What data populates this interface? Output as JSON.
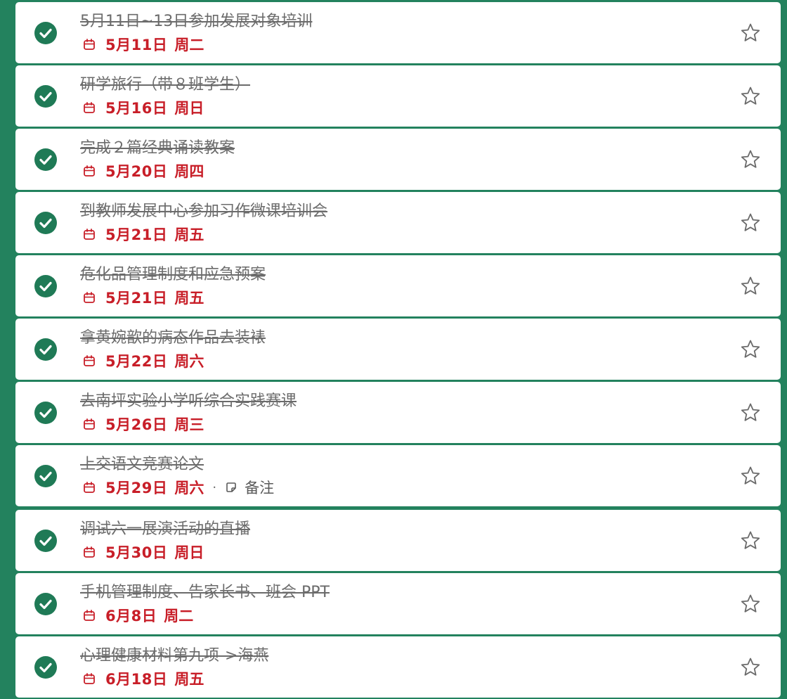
{
  "tasks": [
    {
      "title": "5月11日~13日参加发展对象培训",
      "date": "5月11日",
      "weekday": "周二",
      "completed": true,
      "starred": false
    },
    {
      "title": "研学旅行（带８班学生）",
      "date": "5月16日",
      "weekday": "周日",
      "completed": true,
      "starred": false
    },
    {
      "title": "完成２篇经典诵读教案",
      "date": "5月20日",
      "weekday": "周四",
      "completed": true,
      "starred": false
    },
    {
      "title": "到教师发展中心参加习作微课培训会",
      "date": "5月21日",
      "weekday": "周五",
      "completed": true,
      "starred": false
    },
    {
      "title": "危化品管理制度和应急预案",
      "date": "5月21日",
      "weekday": "周五",
      "completed": true,
      "starred": false
    },
    {
      "title": "拿黄婉歆的病态作品去装裱",
      "date": "5月22日",
      "weekday": "周六",
      "completed": true,
      "starred": false
    },
    {
      "title": "去南坪实验小学听综合实践赛课",
      "date": "5月26日",
      "weekday": "周三",
      "completed": true,
      "starred": false
    },
    {
      "title": "上交语文竞赛论文",
      "date": "5月29日",
      "weekday": "周六",
      "note": "备注",
      "completed": true,
      "starred": false
    },
    {
      "title": "调试六一展演活动的直播",
      "date": "5月30日",
      "weekday": "周日",
      "completed": true,
      "starred": false
    },
    {
      "title": "手机管理制度、告家长书、班会 PPT",
      "date": "6月8日",
      "weekday": "周二",
      "completed": true,
      "starred": false
    },
    {
      "title": "心理健康材料第九项->海燕",
      "date": "6月18日",
      "weekday": "周五",
      "completed": true,
      "starred": false
    }
  ],
  "icons": {
    "completed": "check-circle-icon",
    "due_date": "calendar-icon",
    "note": "note-icon",
    "importance": "star-outline-icon"
  },
  "colors": {
    "background": "#23825e",
    "check": "#1f7a56",
    "date": "#c81e28",
    "title_completed": "#6b6b6b"
  }
}
